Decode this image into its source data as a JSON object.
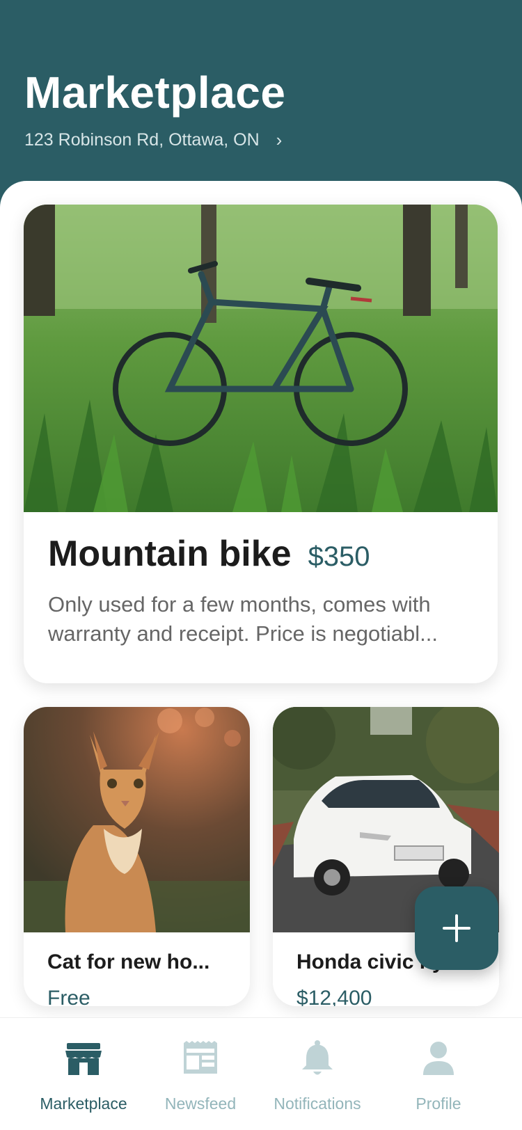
{
  "header": {
    "title": "Marketplace",
    "address": "123 Robinson Rd, Ottawa, ON",
    "address_chevron": "›",
    "background_color": "#2b5d65"
  },
  "featured": {
    "image_icon": "bicycle-photo",
    "title": "Mountain bike",
    "price": "$350",
    "description": "Only used for a few months, comes with warranty and receipt. Price is negotiabl..."
  },
  "listings": [
    {
      "image_icon": "cat-photo",
      "title": "Cat for new ho...",
      "price": "Free"
    },
    {
      "image_icon": "car-photo",
      "title": "Honda civic hybrid",
      "price": "$12,400"
    }
  ],
  "fab": {
    "icon": "plus-icon"
  },
  "tabs": [
    {
      "label": "Marketplace",
      "icon": "store-icon",
      "active": true
    },
    {
      "label": "Newsfeed",
      "icon": "newspaper-icon",
      "active": false
    },
    {
      "label": "Notifications",
      "icon": "bell-icon",
      "active": false
    },
    {
      "label": "Profile",
      "icon": "person-icon",
      "active": false
    }
  ],
  "colors": {
    "accent": "#2b5d65",
    "inactive_tab": "#93b5ba",
    "text_primary": "#1c1c1c",
    "text_secondary": "#666666"
  }
}
